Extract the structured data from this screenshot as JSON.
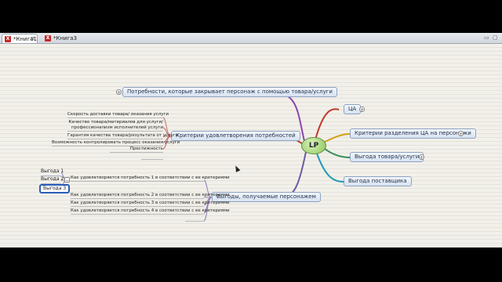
{
  "tabs": [
    {
      "label": "*Книга1",
      "close": "⊠"
    },
    {
      "label": "*Книга3"
    }
  ],
  "window_controls": [
    "▭",
    "▢"
  ],
  "mindmap": {
    "root": "LP",
    "right_topics": [
      {
        "label": "ЦА",
        "expander": "+"
      },
      {
        "label": "Критерии разделения ЦА на персонажи",
        "expander": "+"
      },
      {
        "label": "Выгода товара/услуги",
        "expander": "+"
      },
      {
        "label": "Выгода поставщика"
      }
    ],
    "left_topics": [
      {
        "label": "Потребности, которые закрывает персонаж с помощью товара/услуги",
        "expander": "+"
      },
      {
        "label": "Критерии удовлетворения потребностей"
      },
      {
        "label": "Выгоды, получаемые персонажем"
      }
    ],
    "criteria_items": [
      "Скорость доставки товара/ оказания услуги",
      "Качество товара/материалов для услуги/",
      "профессионализм исполнителей услуги",
      "Гарантия качества товара/результата от услуги",
      "Возможность контролировать процесс оказания услуги",
      "Престижность"
    ],
    "benefit_items": [
      "Как удовлетворяется потребность 1 в соответствии с ее критериями",
      "Как удовлетворяется потребность 2 в соответствии с ее критериями",
      "Как удовлетворяется потребность 3 в соответствии с ее критериями",
      "Как удовлетворяется потребность 4 в соответствии с ее критериями"
    ],
    "benefit_labels": [
      "Выгода 1",
      "Выгода 2",
      "Выгода 3"
    ],
    "collapse_marker": "−"
  }
}
